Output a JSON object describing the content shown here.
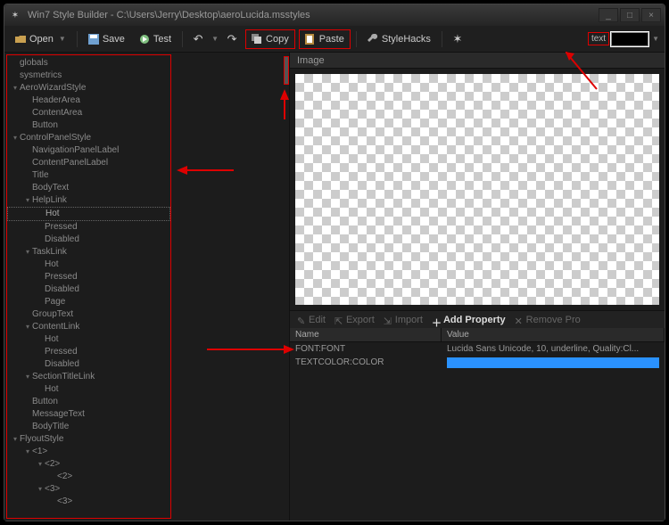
{
  "window": {
    "title": "Win7 Style Builder - C:\\Users\\Jerry\\Desktop\\aeroLucida.msstyles",
    "min_label": "_",
    "max_label": "□",
    "close_label": "×"
  },
  "toolbar": {
    "open": "Open",
    "save": "Save",
    "test": "Test",
    "copy": "Copy",
    "paste": "Paste",
    "stylehacks": "StyleHacks",
    "search_label": "text",
    "search_value": ""
  },
  "tree": {
    "items": [
      {
        "label": "globals",
        "depth": 0,
        "arrow": ""
      },
      {
        "label": "sysmetrics",
        "depth": 0,
        "arrow": ""
      },
      {
        "label": "AeroWizardStyle",
        "depth": 0,
        "arrow": "▾"
      },
      {
        "label": "HeaderArea",
        "depth": 1,
        "arrow": ""
      },
      {
        "label": "ContentArea",
        "depth": 1,
        "arrow": ""
      },
      {
        "label": "Button",
        "depth": 1,
        "arrow": ""
      },
      {
        "label": "ControlPanelStyle",
        "depth": 0,
        "arrow": "▾"
      },
      {
        "label": "NavigationPanelLabel",
        "depth": 1,
        "arrow": ""
      },
      {
        "label": "ContentPanelLabel",
        "depth": 1,
        "arrow": ""
      },
      {
        "label": "Title",
        "depth": 1,
        "arrow": ""
      },
      {
        "label": "BodyText",
        "depth": 1,
        "arrow": ""
      },
      {
        "label": "HelpLink",
        "depth": 1,
        "arrow": "▾"
      },
      {
        "label": "Hot",
        "depth": 2,
        "arrow": "",
        "sel": true
      },
      {
        "label": "Pressed",
        "depth": 2,
        "arrow": ""
      },
      {
        "label": "Disabled",
        "depth": 2,
        "arrow": ""
      },
      {
        "label": "TaskLink",
        "depth": 1,
        "arrow": "▾"
      },
      {
        "label": "Hot",
        "depth": 2,
        "arrow": ""
      },
      {
        "label": "Pressed",
        "depth": 2,
        "arrow": ""
      },
      {
        "label": "Disabled",
        "depth": 2,
        "arrow": ""
      },
      {
        "label": "Page",
        "depth": 2,
        "arrow": ""
      },
      {
        "label": "GroupText",
        "depth": 1,
        "arrow": ""
      },
      {
        "label": "ContentLink",
        "depth": 1,
        "arrow": "▾"
      },
      {
        "label": "Hot",
        "depth": 2,
        "arrow": ""
      },
      {
        "label": "Pressed",
        "depth": 2,
        "arrow": ""
      },
      {
        "label": "Disabled",
        "depth": 2,
        "arrow": ""
      },
      {
        "label": "SectionTitleLink",
        "depth": 1,
        "arrow": "▾"
      },
      {
        "label": "Hot",
        "depth": 2,
        "arrow": ""
      },
      {
        "label": "Button",
        "depth": 1,
        "arrow": ""
      },
      {
        "label": "MessageText",
        "depth": 1,
        "arrow": ""
      },
      {
        "label": "BodyTitle",
        "depth": 1,
        "arrow": ""
      },
      {
        "label": "FlyoutStyle",
        "depth": 0,
        "arrow": "▾"
      },
      {
        "label": "<1>",
        "depth": 1,
        "arrow": "▾"
      },
      {
        "label": "<2>",
        "depth": 2,
        "arrow": "▾"
      },
      {
        "label": "<2>",
        "depth": 3,
        "arrow": ""
      },
      {
        "label": "<3>",
        "depth": 2,
        "arrow": "▾"
      },
      {
        "label": "<3>",
        "depth": 3,
        "arrow": ""
      }
    ]
  },
  "image_section": {
    "title": "Image"
  },
  "propbar": {
    "edit": "Edit",
    "export": "Export",
    "import": "Import",
    "add": "Add Property",
    "remove": "Remove Pro"
  },
  "proptable": {
    "col_name": "Name",
    "col_value": "Value",
    "rows": [
      {
        "name": "FONT:FONT",
        "value": "Lucida Sans Unicode, 10, underline, Quality:Cl..."
      },
      {
        "name": "TEXTCOLOR:COLOR",
        "value": "",
        "color": true
      }
    ]
  },
  "colors": {
    "highlight": "#2a92ff"
  }
}
